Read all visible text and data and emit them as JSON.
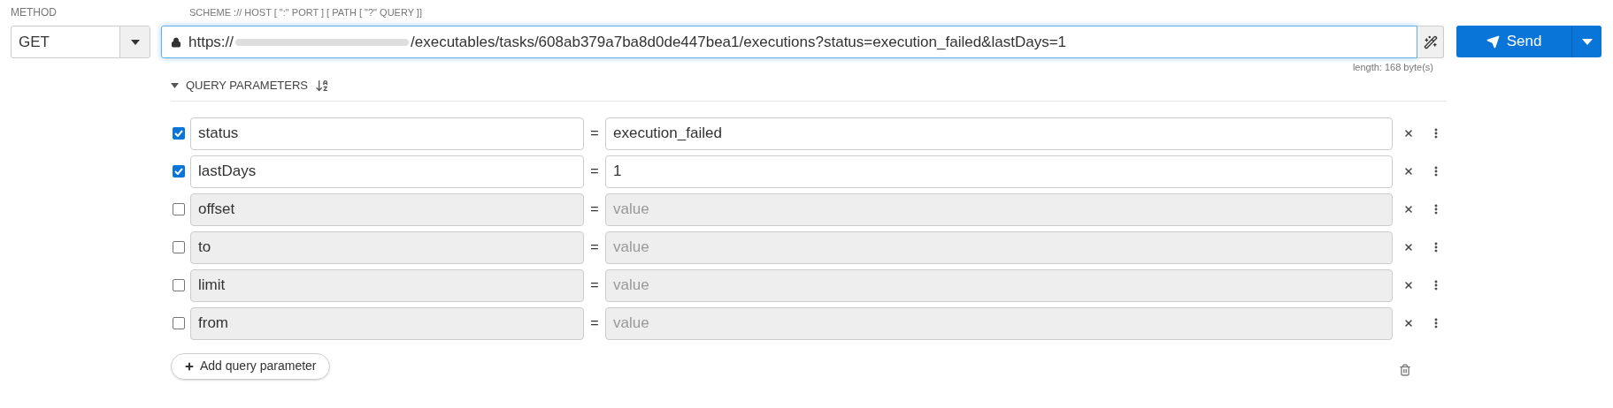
{
  "method": {
    "label": "METHOD",
    "value": "GET"
  },
  "url": {
    "label": "SCHEME :// HOST [ \":\" PORT ] [ PATH [ \"?\" QUERY ]]",
    "scheme": "https://",
    "rest": "/executables/tasks/608ab379a7ba8d0de447bea1/executions?status=execution_failed&lastDays=1",
    "length": "length: 168 byte(s)"
  },
  "send_button": "Send",
  "query_parameters": {
    "title": "QUERY PARAMETERS",
    "expanded": true,
    "params": [
      {
        "name": "status",
        "value": "execution_failed",
        "checked": true
      },
      {
        "name": "lastDays",
        "value": "1",
        "checked": true
      },
      {
        "name": "offset",
        "placeholder": "value",
        "checked": false
      },
      {
        "name": "to",
        "placeholder": "value",
        "checked": false
      },
      {
        "name": "limit",
        "placeholder": "value",
        "checked": false
      },
      {
        "name": "from",
        "placeholder": "value",
        "checked": false
      }
    ],
    "add_button": "Add query parameter",
    "separator": "="
  }
}
